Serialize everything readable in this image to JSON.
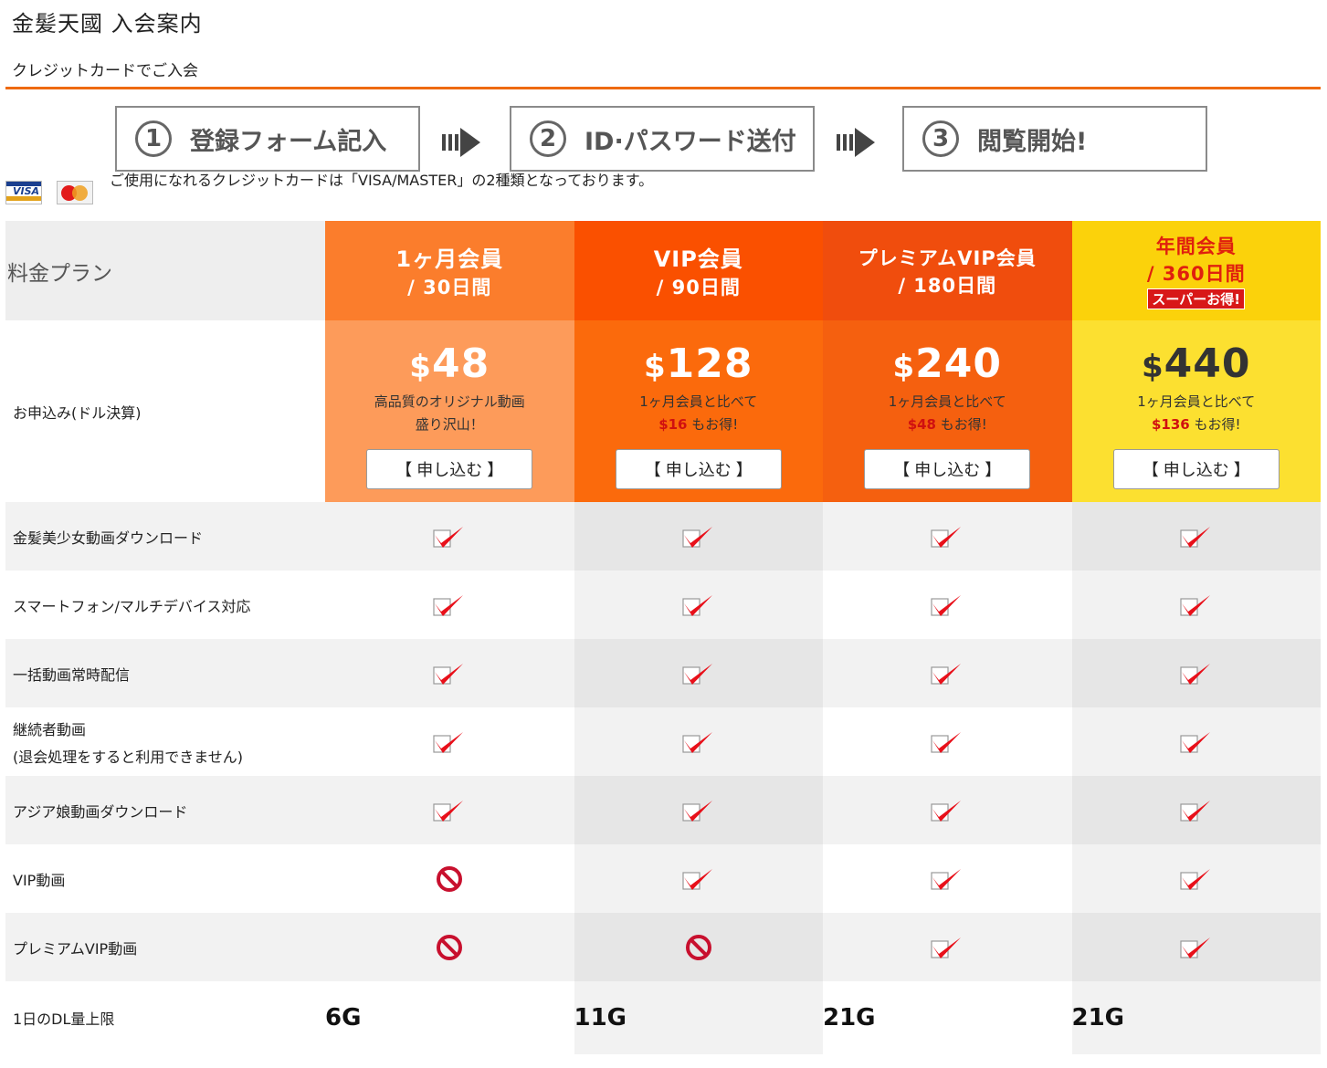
{
  "header": {
    "site_title": "金髪天國 入会案内",
    "subtitle": "クレジットカードでご入会"
  },
  "steps": [
    {
      "num": "1",
      "label": "登録フォーム記入"
    },
    {
      "num": "2",
      "label": "ID·パスワード送付"
    },
    {
      "num": "3",
      "label": "閲覧開始!"
    }
  ],
  "cards": {
    "visa_text": "VISA",
    "note": "ご使用になれるクレジットカードは「VISA/MASTER」の2種類となっております。"
  },
  "table": {
    "plan_label": "料金プラン",
    "price_label": "お申込み(ドル決算)",
    "plans": [
      {
        "name": "1ヶ月会員",
        "period": "/ 30日間",
        "badge": "",
        "currency": "$",
        "price": "48",
        "desc1": "高品質のオリジナル動画",
        "desc2_save": "",
        "desc2": "盛り沢山！",
        "button": "【 申し込む 】"
      },
      {
        "name": "VIP会員",
        "period": "/ 90日間",
        "badge": "",
        "currency": "$",
        "price": "128",
        "desc1": "1ヶ月会員と比べて",
        "desc2_save": "$16",
        "desc2": " もお得!",
        "button": "【 申し込む 】"
      },
      {
        "name": "プレミアムVIP会員",
        "period": "/ 180日間",
        "badge": "",
        "currency": "$",
        "price": "240",
        "desc1": "1ヶ月会員と比べて",
        "desc2_save": "$48",
        "desc2": " もお得!",
        "button": "【 申し込む 】"
      },
      {
        "name": "年間会員",
        "period": "/ 360日間",
        "badge": "スーパーお得!",
        "currency": "$",
        "price": "440",
        "desc1": "1ヶ月会員と比べて",
        "desc2_save": "$136",
        "desc2": " もお得!",
        "button": "【 申し込む 】"
      }
    ],
    "features": [
      {
        "label": "金髪美少女動画ダウンロード",
        "label2": "",
        "values": [
          "check",
          "check",
          "check",
          "check"
        ]
      },
      {
        "label": "スマートフォン/マルチデバイス対応",
        "label2": "",
        "values": [
          "check",
          "check",
          "check",
          "check"
        ]
      },
      {
        "label": "一括動画常時配信",
        "label2": "",
        "values": [
          "check",
          "check",
          "check",
          "check"
        ]
      },
      {
        "label": "継続者動画",
        "label2": "(退会処理をすると利用できません)",
        "values": [
          "check",
          "check",
          "check",
          "check"
        ]
      },
      {
        "label": "アジア娘動画ダウンロード",
        "label2": "",
        "values": [
          "check",
          "check",
          "check",
          "check"
        ]
      },
      {
        "label": "VIP動画",
        "label2": "",
        "values": [
          "no",
          "check",
          "check",
          "check"
        ]
      },
      {
        "label": "プレミアムVIP動画",
        "label2": "",
        "values": [
          "no",
          "no",
          "check",
          "check"
        ]
      }
    ],
    "dl_label": "1日のDL量上限",
    "dl_values": [
      "6G",
      "11G",
      "21G",
      "21G"
    ]
  },
  "colors": {
    "accent_orange": "#ee6a10",
    "check_red": "#e8101a",
    "save_red": "#d01010",
    "annual_yellow": "#fbd20b"
  },
  "icons": {
    "check": "red-check-icon",
    "no": "prohibited-icon"
  }
}
